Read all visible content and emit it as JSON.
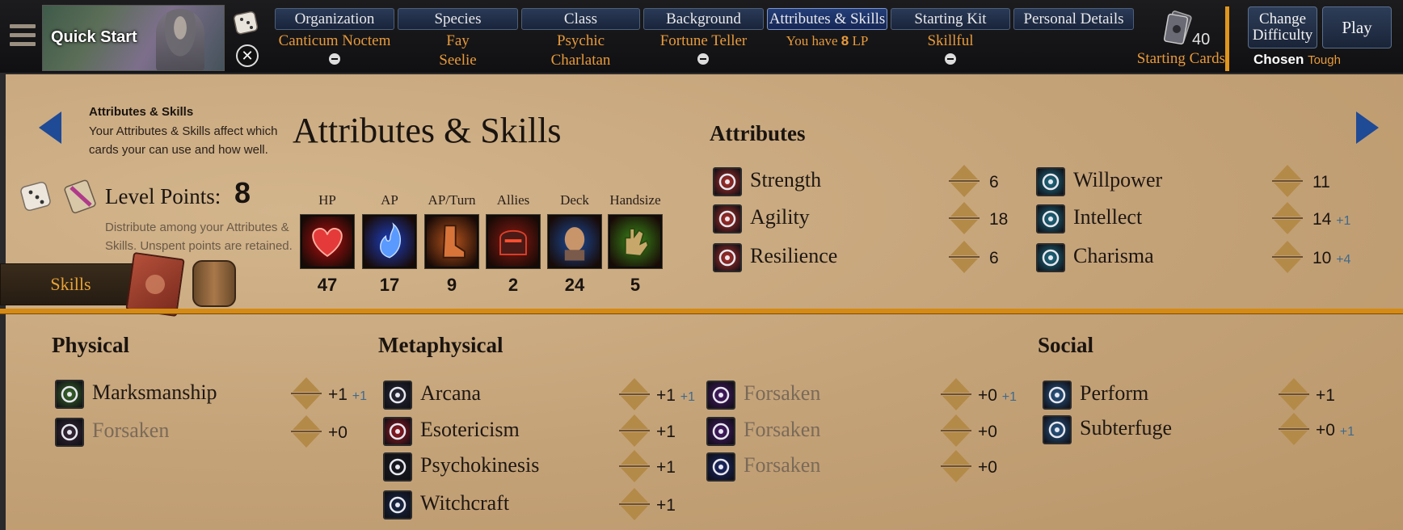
{
  "topbar": {
    "quick_start": "Quick Start",
    "tabs": [
      {
        "label": "Organization",
        "value1": "Canticum Noctem",
        "value2": ""
      },
      {
        "label": "Species",
        "value1": "Fay",
        "value2": "Seelie"
      },
      {
        "label": "Class",
        "value1": "Psychic",
        "value2": "Charlatan"
      },
      {
        "label": "Background",
        "value1": "Fortune Teller",
        "value2": ""
      },
      {
        "label": "Attributes & Skills",
        "value1_prefix": "You have ",
        "value1_num": "8",
        "value1_suffix": " LP"
      },
      {
        "label": "Starting Kit",
        "value1": "Skillful",
        "value2": ""
      },
      {
        "label": "Personal Details"
      }
    ],
    "starting_cards_count": "40",
    "starting_cards_label": "Starting Cards",
    "change_difficulty": "Change Difficulty",
    "play": "Play",
    "chosen_label": "Chosen",
    "chosen_value": "Tough"
  },
  "page": {
    "info_title": "Attributes & Skills",
    "info_text": "Your Attributes & Skills affect which cards your can use and how well.",
    "title": "Attributes & Skills",
    "level_points_label": "Level Points:",
    "level_points_value": "8",
    "lp_hint": "Distribute among your Attributes & Skills. Unspent points are retained.",
    "skills_tab": "Skills"
  },
  "stats": [
    {
      "label": "HP",
      "value": "47",
      "icon": "heart-icon",
      "color": "#b31010"
    },
    {
      "label": "AP",
      "value": "17",
      "icon": "blue-flame-icon",
      "color": "#1c3fbf"
    },
    {
      "label": "AP/Turn",
      "value": "9",
      "icon": "boot-icon",
      "color": "#b5531c"
    },
    {
      "label": "Allies",
      "value": "2",
      "icon": "helmet-icon",
      "color": "#8a1a12"
    },
    {
      "label": "Deck",
      "value": "24",
      "icon": "head-icon",
      "color": "#1a4a9a"
    },
    {
      "label": "Handsize",
      "value": "5",
      "icon": "hand-icon",
      "color": "#3a8a1a"
    }
  ],
  "attributes": {
    "heading": "Attributes",
    "left": [
      {
        "name": "Strength",
        "value": "6",
        "bonus": "",
        "color": "#b0302a"
      },
      {
        "name": "Agility",
        "value": "18",
        "bonus": "",
        "color": "#b0302a"
      },
      {
        "name": "Resilience",
        "value": "6",
        "bonus": "",
        "color": "#b0302a"
      }
    ],
    "right": [
      {
        "name": "Willpower",
        "value": "11",
        "bonus": "",
        "color": "#1f6f86"
      },
      {
        "name": "Intellect",
        "value": "14",
        "bonus": "+1",
        "color": "#1f6f86"
      },
      {
        "name": "Charisma",
        "value": "10",
        "bonus": "+4",
        "color": "#1f6f86"
      }
    ]
  },
  "skills": {
    "physical": {
      "heading": "Physical",
      "items": [
        {
          "name": "Marksmanship",
          "value": "+1",
          "bonus": "+1",
          "dim": false,
          "color": "#3a6a2a"
        },
        {
          "name": "Forsaken",
          "value": "+0",
          "bonus": "",
          "dim": true,
          "color": "#3a2a3a"
        }
      ]
    },
    "metaphysical": {
      "heading": "Metaphysical",
      "col1": [
        {
          "name": "Arcana",
          "value": "+1",
          "bonus": "+1",
          "dim": false,
          "color": "#2a2a3a"
        },
        {
          "name": "Esotericism",
          "value": "+1",
          "bonus": "",
          "dim": false,
          "color": "#9a1a22"
        },
        {
          "name": "Psychokinesis",
          "value": "+1",
          "bonus": "",
          "dim": false,
          "color": "#1a1a22"
        },
        {
          "name": "Witchcraft",
          "value": "+1",
          "bonus": "",
          "dim": false,
          "color": "#1a2a4a"
        }
      ],
      "col2": [
        {
          "name": "Forsaken",
          "value": "+0",
          "bonus": "+1",
          "dim": true,
          "color": "#4a1a6a"
        },
        {
          "name": "Forsaken",
          "value": "+0",
          "bonus": "",
          "dim": true,
          "color": "#4a1a6a"
        },
        {
          "name": "Forsaken",
          "value": "+0",
          "bonus": "",
          "dim": true,
          "color": "#1a2a6a"
        }
      ]
    },
    "social": {
      "heading": "Social",
      "items": [
        {
          "name": "Perform",
          "value": "+1",
          "bonus": "",
          "dim": false,
          "color": "#2a5a8a"
        },
        {
          "name": "Subterfuge",
          "value": "+0",
          "bonus": "+1",
          "dim": false,
          "color": "#2a5a8a"
        }
      ]
    }
  }
}
